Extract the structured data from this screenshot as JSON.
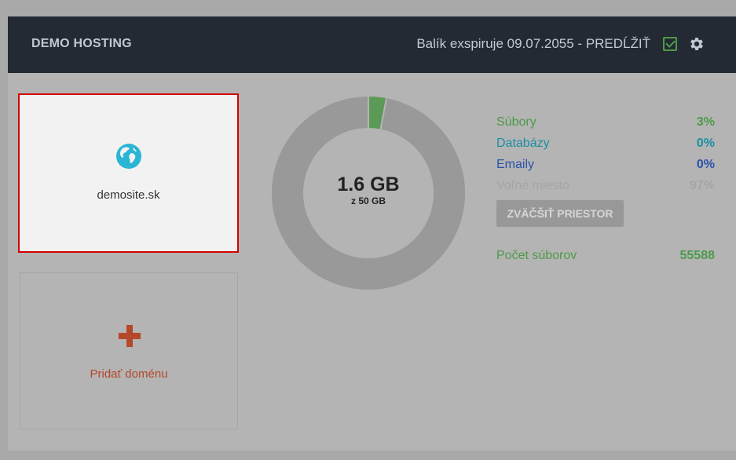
{
  "header": {
    "brand": "DEMO HOSTING",
    "expiry_text": "Balík exspiruje 09.07.2055 - ",
    "renew_label": "PREDĹŽIŤ",
    "icons": [
      "check-square-icon",
      "gear-icon"
    ]
  },
  "domains": {
    "items": [
      {
        "name": "demosite.sk",
        "icon": "globe-icon"
      }
    ],
    "add_label": "Pridať doménu"
  },
  "storage": {
    "used": "1.6 GB",
    "total": "z 50 GB",
    "stats": [
      {
        "label": "Súbory",
        "value": "3%",
        "color": "#4e9a4a"
      },
      {
        "label": "Databázy",
        "value": "0%",
        "color": "#1a8fa3"
      },
      {
        "label": "Emaily",
        "value": "0%",
        "color": "#2a52a8"
      },
      {
        "label": "Voľné miesto",
        "value": "97%",
        "color": "#a5a5a5"
      }
    ],
    "expand_label": "ZVÄČŠIŤ PRIESTOR",
    "file_count_label": "Počet súborov",
    "file_count_value": "55588"
  },
  "chart_data": {
    "type": "pie",
    "categories": [
      "Súbory",
      "Databázy",
      "Emaily",
      "Voľné miesto"
    ],
    "values": [
      3,
      0,
      0,
      97
    ],
    "colors": [
      "#5b9a57",
      "#1a8fa3",
      "#2a52a8",
      "#999999"
    ]
  }
}
